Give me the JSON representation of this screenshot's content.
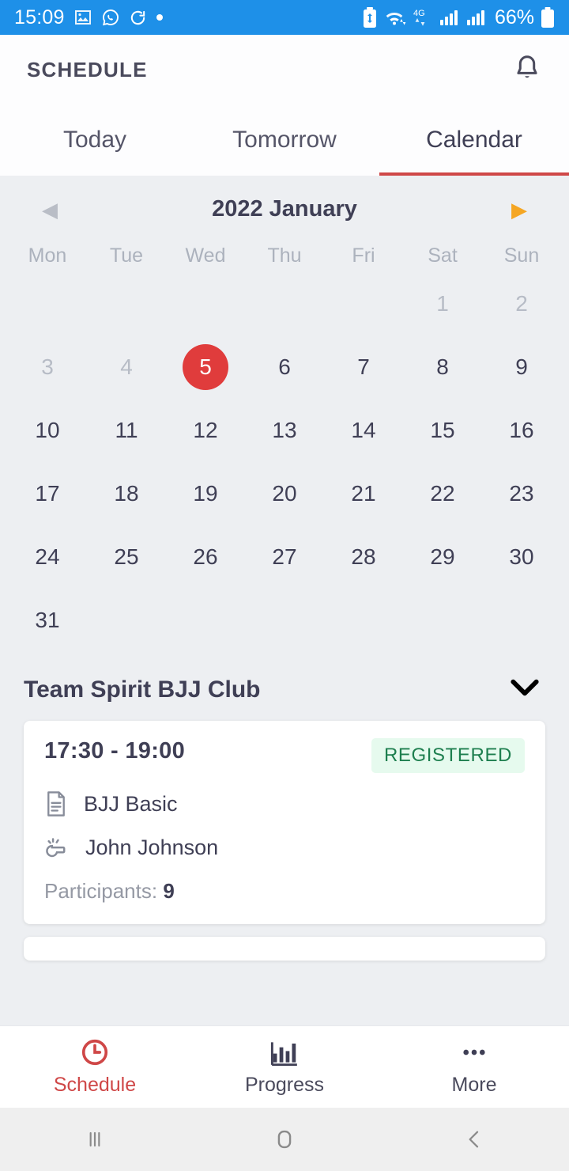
{
  "status_bar": {
    "time": "15:09",
    "battery_percent": "66%",
    "network": "4G",
    "left_icons": [
      "image-icon",
      "whatsapp-icon",
      "sync-icon",
      "dot-icon"
    ],
    "right_icons": [
      "battery-saver-icon",
      "wifi-icon",
      "mobile-data-icon",
      "signal-bars-icon-1",
      "signal-bars-icon-2",
      "battery-icon"
    ],
    "background": "#1E90E8"
  },
  "app_bar": {
    "title": "SCHEDULE",
    "notification_icon": "bell-icon"
  },
  "tabs": {
    "items": [
      {
        "label": "Today",
        "active": false
      },
      {
        "label": "Tomorrow",
        "active": false
      },
      {
        "label": "Calendar",
        "active": true
      }
    ],
    "active_color": "#CF4747"
  },
  "calendar": {
    "month_label": "2022 January",
    "prev_arrow": "◀",
    "next_arrow": "▶",
    "prev_enabled": false,
    "next_enabled": true,
    "weekdays": [
      "Mon",
      "Tue",
      "Wed",
      "Thu",
      "Fri",
      "Sat",
      "Sun"
    ],
    "selected_day": "5",
    "selected_color": "#E03C3C",
    "weeks": [
      [
        {
          "label": "",
          "state": "empty"
        },
        {
          "label": "",
          "state": "empty"
        },
        {
          "label": "",
          "state": "empty"
        },
        {
          "label": "",
          "state": "empty"
        },
        {
          "label": "",
          "state": "empty"
        },
        {
          "label": "1",
          "state": "muted"
        },
        {
          "label": "2",
          "state": "muted"
        }
      ],
      [
        {
          "label": "3",
          "state": "muted"
        },
        {
          "label": "4",
          "state": "muted"
        },
        {
          "label": "5",
          "state": "selected"
        },
        {
          "label": "6",
          "state": "normal"
        },
        {
          "label": "7",
          "state": "normal"
        },
        {
          "label": "8",
          "state": "normal"
        },
        {
          "label": "9",
          "state": "normal"
        }
      ],
      [
        {
          "label": "10",
          "state": "normal"
        },
        {
          "label": "11",
          "state": "normal"
        },
        {
          "label": "12",
          "state": "normal"
        },
        {
          "label": "13",
          "state": "normal"
        },
        {
          "label": "14",
          "state": "normal"
        },
        {
          "label": "15",
          "state": "normal"
        },
        {
          "label": "16",
          "state": "normal"
        }
      ],
      [
        {
          "label": "17",
          "state": "normal"
        },
        {
          "label": "18",
          "state": "normal"
        },
        {
          "label": "19",
          "state": "normal"
        },
        {
          "label": "20",
          "state": "normal"
        },
        {
          "label": "21",
          "state": "normal"
        },
        {
          "label": "22",
          "state": "normal"
        },
        {
          "label": "23",
          "state": "normal"
        }
      ],
      [
        {
          "label": "24",
          "state": "normal"
        },
        {
          "label": "25",
          "state": "normal"
        },
        {
          "label": "26",
          "state": "normal"
        },
        {
          "label": "27",
          "state": "normal"
        },
        {
          "label": "28",
          "state": "normal"
        },
        {
          "label": "29",
          "state": "normal"
        },
        {
          "label": "30",
          "state": "normal"
        }
      ],
      [
        {
          "label": "31",
          "state": "normal"
        },
        {
          "label": "",
          "state": "empty"
        },
        {
          "label": "",
          "state": "empty"
        },
        {
          "label": "",
          "state": "empty"
        },
        {
          "label": "",
          "state": "empty"
        },
        {
          "label": "",
          "state": "empty"
        },
        {
          "label": "",
          "state": "empty"
        }
      ]
    ]
  },
  "club": {
    "name": "Team Spirit BJJ Club",
    "expand_icon": "chevron-down-icon"
  },
  "events": [
    {
      "time": "17:30 - 19:00",
      "status": "REGISTERED",
      "status_bg": "#E6FAEE",
      "status_color": "#1E7F4F",
      "class_name": "BJJ Basic",
      "class_icon": "document-icon",
      "coach": "John Johnson",
      "coach_icon": "whistle-icon",
      "participants_label": "Participants:",
      "participants_count": "9"
    }
  ],
  "bottom_nav": {
    "items": [
      {
        "label": "Schedule",
        "icon": "clock-icon",
        "active": true
      },
      {
        "label": "Progress",
        "icon": "bar-chart-icon",
        "active": false
      },
      {
        "label": "More",
        "icon": "ellipsis-icon",
        "active": false
      }
    ],
    "active_color": "#CF4747"
  },
  "android_nav": {
    "recents_icon": "recents-icon",
    "home_icon": "home-icon",
    "back_icon": "back-icon"
  }
}
